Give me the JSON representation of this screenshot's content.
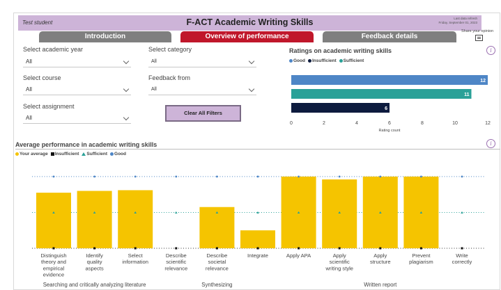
{
  "header": {
    "student": "Test student",
    "title": "F-ACT Academic Writing Skills",
    "updated_line1": "Last data refresh",
    "updated_line2": "Friday, September 01, 2023"
  },
  "tabs": [
    {
      "label": "Introduction"
    },
    {
      "label": "Overview of performance"
    },
    {
      "label": "Feedback details"
    }
  ],
  "share": {
    "label": "Share your opinion"
  },
  "filters": {
    "year": {
      "label": "Select academic year",
      "value": "All"
    },
    "course": {
      "label": "Select course",
      "value": "All"
    },
    "assignment": {
      "label": "Select assignment",
      "value": "All"
    },
    "category": {
      "label": "Select category",
      "value": "All"
    },
    "feedback_from": {
      "label": "Feedback from",
      "value": "All"
    },
    "clear_label": "Clear All Filters"
  },
  "ratings": {
    "title": "Ratings on academic writing skills",
    "legend": [
      {
        "label": "Good",
        "color": "#4e86c6"
      },
      {
        "label": "Insufficient",
        "color": "#0d1b3e"
      },
      {
        "label": "Sufficient",
        "color": "#2aa198"
      }
    ]
  },
  "performance": {
    "title": "Average performance in academic writing skills",
    "legend": [
      {
        "label": "Your average",
        "color": "#f5c400",
        "shape": "dot"
      },
      {
        "label": "Insufficient",
        "color": "#111111",
        "shape": "square"
      },
      {
        "label": "Sufficient",
        "color": "#2aa198",
        "shape": "triangle"
      },
      {
        "label": "Good",
        "color": "#4e86c6",
        "shape": "dot"
      }
    ]
  },
  "chart_data": [
    {
      "type": "bar",
      "orientation": "horizontal",
      "title": "Ratings on academic writing skills",
      "categories": [
        "Good",
        "Sufficient",
        "Insufficient"
      ],
      "values": [
        12,
        11,
        6
      ],
      "colors": [
        "#4e86c6",
        "#2aa198",
        "#0d1b3e"
      ],
      "xlabel": "Rating count",
      "xlim": [
        0,
        12
      ],
      "xticks": [
        0,
        2,
        4,
        6,
        8,
        10,
        12
      ],
      "data_labels": true
    },
    {
      "type": "bar",
      "title": "Average performance in academic writing skills",
      "categories": [
        "Distinguish theory and empirical evidence",
        "Identify quality aspects",
        "Select information",
        "Describe scientific relevance",
        "Describe societal relevance",
        "Integrate",
        "Apply APA",
        "Apply scientific writing style",
        "Apply structure",
        "Prevent plagiarism",
        "Write correctly"
      ],
      "category_lines": [
        [
          "Distinguish",
          "theory and",
          "empirical",
          "evidence"
        ],
        [
          "Identify",
          "quality",
          "aspects"
        ],
        [
          "Select",
          "information"
        ],
        [
          "Describe",
          "scientific",
          "relevance"
        ],
        [
          "Describe",
          "societal",
          "relevance"
        ],
        [
          "Integrate"
        ],
        [
          "Apply APA"
        ],
        [
          "Apply",
          "scientific",
          "writing style"
        ],
        [
          "Apply",
          "structure"
        ],
        [
          "Prevent",
          "plagiarism"
        ],
        [
          "Write",
          "correctly"
        ]
      ],
      "groups": [
        {
          "label": "Searching and critically analyzing literature",
          "from": 0,
          "to": 2
        },
        {
          "label": "Synthesizing",
          "from": 3,
          "to": 5
        },
        {
          "label": "Written report",
          "from": 6,
          "to": 10
        }
      ],
      "series": [
        {
          "name": "Your average",
          "values": [
            2.55,
            2.6,
            2.62,
            1.0,
            2.15,
            1.5,
            3.0,
            2.92,
            3.0,
            3.0,
            null
          ],
          "color": "#f5c400"
        },
        {
          "name": "Insufficient",
          "values": [
            1,
            1,
            1,
            1,
            1,
            1,
            1,
            1,
            1,
            1,
            1
          ],
          "color": "#111111"
        },
        {
          "name": "Sufficient",
          "values": [
            2,
            2,
            2,
            2,
            2,
            2,
            2,
            2,
            2,
            2,
            2
          ],
          "color": "#2aa198"
        },
        {
          "name": "Good",
          "values": [
            3,
            3,
            3,
            3,
            3,
            3,
            3,
            3,
            3,
            3,
            3
          ],
          "color": "#4e86c6"
        }
      ],
      "ylim": [
        1,
        3.25
      ]
    }
  ]
}
